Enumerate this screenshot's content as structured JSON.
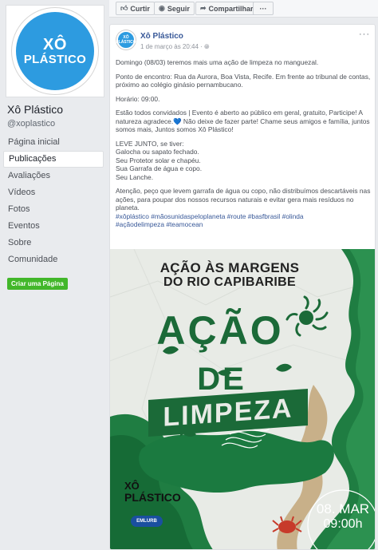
{
  "sidebar": {
    "logo_line1": "XÔ",
    "logo_line2": "PLÁSTICO",
    "page_name": "Xô Plástico",
    "handle": "@xoplastico",
    "items": [
      {
        "label": "Página inicial"
      },
      {
        "label": "Publicações"
      },
      {
        "label": "Avaliações"
      },
      {
        "label": "Vídeos"
      },
      {
        "label": "Fotos"
      },
      {
        "label": "Eventos"
      },
      {
        "label": "Sobre"
      },
      {
        "label": "Comunidade"
      }
    ],
    "active_index": 1,
    "create_page_label": "Criar uma Página"
  },
  "actions": {
    "like": "Curtir",
    "follow": "Seguir",
    "share": "Compartilhar",
    "more": "···"
  },
  "post": {
    "author": "Xô Plástico",
    "timestamp": "1 de março às 20:44 ·",
    "body": {
      "p1": "Domingo (08/03) teremos mais uma ação de limpeza no manguezal.",
      "p2": "Ponto de encontro: Rua da Aurora, Boa Vista, Recife. Em frente ao tribunal de contas, próximo ao colégio ginásio pernambucano.",
      "p3": "Horário: 09:00.",
      "p4": "Estão todos convidados | Evento é aberto ao público em geral, gratuito, Participe! A natureza agradece.💙 Não deixe de fazer parte! Chame seus amigos e família, juntos somos mais, Juntos somos Xô Plástico!",
      "list_title": "LEVE JUNTO, se tiver:",
      "list": [
        "Galocha ou sapato fechado.",
        "Seu Protetor solar e chapéu.",
        "Sua Garrafa de água e copo.",
        "Seu Lanche."
      ],
      "p5": "Atenção, peço que levem garrafa de água ou copo, não distribuímos descartáveis nas ações, para poupar dos nossos recursos naturais e evitar gera mais resíduos no planeta.",
      "hashtags_line1": "#xôplástico #mãosunidaspeloplaneta #route #basfbrasil #olinda",
      "hashtags_line2": "#açãodelimpeza #teamocean"
    }
  },
  "poster": {
    "headline1": "AÇÃO ÀS MARGENS",
    "headline2": "DO RIO CAPIBARIBE",
    "title1": "AÇÃO",
    "title2": "DE",
    "title3": "LIMPEZA",
    "brand1": "XÔ",
    "brand2": "PLÁSTICO",
    "partner": "EMLURB",
    "date": "08. MAR",
    "time": "09:00h",
    "colors": {
      "paper": "#e9ebe7",
      "green_dark": "#0f6e3a",
      "green_mid": "#2f8f4a",
      "beige": "#c9b187",
      "title": "#1b6a38"
    }
  }
}
